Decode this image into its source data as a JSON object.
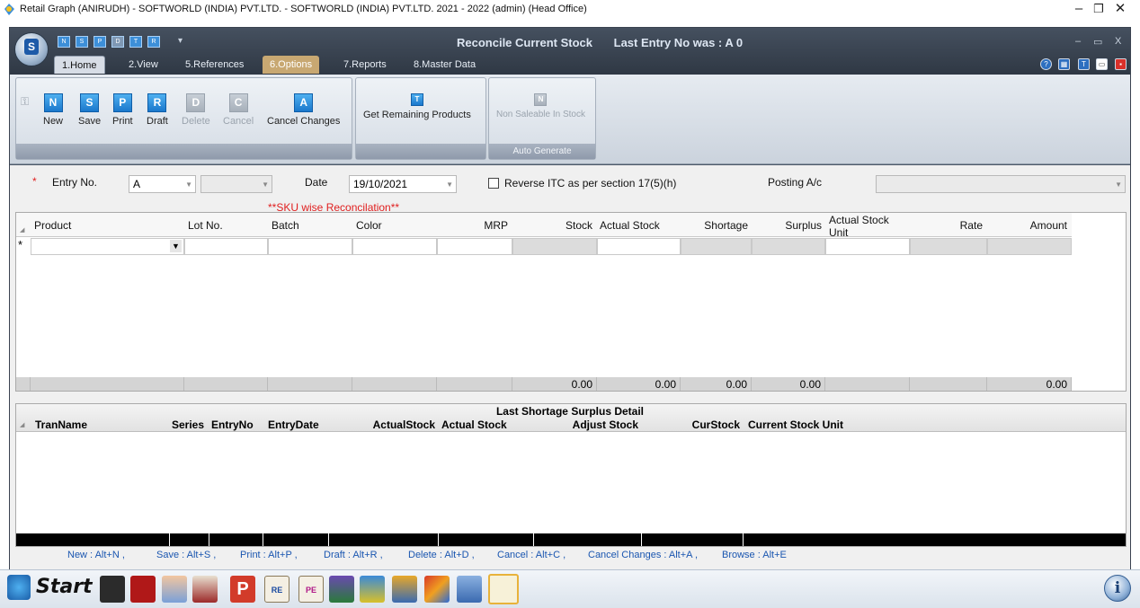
{
  "window": {
    "title": "Retail Graph (ANIRUDH) - SOFTWORLD (INDIA) PVT.LTD. - SOFTWORLD (INDIA) PVT.LTD.  2021 - 2022 (admin) (Head Office)",
    "minimize": "–",
    "restore": "❐",
    "close": "✕"
  },
  "app": {
    "screen_title": "Reconcile Current Stock",
    "last_entry": "Last Entry No was : A 0",
    "orb_letter": "S",
    "win_min": "–",
    "win_max": "▭",
    "win_close": "X"
  },
  "tabs": [
    {
      "label": "1.Home"
    },
    {
      "label": "2.View"
    },
    {
      "label": "5.References"
    },
    {
      "label": "6.Options"
    },
    {
      "label": "7.Reports"
    },
    {
      "label": "8.Master Data"
    }
  ],
  "ribbon": {
    "new": "New",
    "save": "Save",
    "print": "Print",
    "draft": "Draft",
    "delete": "Delete",
    "cancel": "Cancel",
    "cancel_changes": "Cancel Changes",
    "get_remaining": "Get Remaining Products",
    "non_saleable": "Non Saleable In Stock",
    "auto_generate": "Auto Generate",
    "icons": {
      "new": "N",
      "save": "S",
      "print": "P",
      "draft": "R",
      "delete": "D",
      "cancel": "C",
      "cancel_changes": "A",
      "get_remaining": "T",
      "non_saleable": "N"
    }
  },
  "form": {
    "required_mark": "*",
    "entry_no_label": "Entry No.",
    "entry_series": "A",
    "entry_number": "",
    "date_label": "Date",
    "date_value": "19/10/2021",
    "reverse_itc_label": "Reverse ITC as per section 17(5)(h)",
    "posting_label": "Posting A/c",
    "posting_value": "",
    "sku_note": "**SKU wise Reconcilation**"
  },
  "grid": {
    "columns": [
      "Product",
      "Lot No.",
      "Batch",
      "Color",
      "MRP",
      "Stock",
      "Actual Stock",
      "Shortage",
      "Surplus",
      "Actual Stock Unit",
      "Rate",
      "Amount"
    ],
    "new_row_marker": "*",
    "totals": {
      "stock": "0.00",
      "actual_stock": "0.00",
      "shortage": "0.00",
      "surplus": "0.00",
      "amount": "0.00"
    }
  },
  "detail": {
    "title": "Last Shortage Surplus Detail",
    "columns": [
      "TranName",
      "Series",
      "EntryNo",
      "EntryDate",
      "ActualStock",
      "Actual Stock",
      "Adjust Stock",
      "CurStock",
      "Current Stock Unit"
    ]
  },
  "shortcuts": [
    "New : Alt+N ,",
    "Save : Alt+S ,",
    "Print : Alt+P ,",
    "Draft : Alt+R ,",
    "Delete : Alt+D ,",
    "Cancel : Alt+C ,",
    "Cancel Changes : Alt+A ,",
    "Browse : Alt+E"
  ],
  "taskbar": {
    "start_label": "Start",
    "info": "i",
    "app_icons": [
      "book-icon",
      "red-book-icon",
      "user-icon",
      "cash-icon",
      "p-icon",
      "re-clipboard-icon",
      "pe-clipboard-icon",
      "bag-icon",
      "transfer-icon",
      "coin-icon",
      "shapes-icon",
      "printer-icon",
      "stock-icon"
    ]
  },
  "colors": {
    "accent": "#1a78cc",
    "required": "#e02020",
    "shortcut_text": "#1a56b0",
    "options_tab": "#c8a872"
  }
}
